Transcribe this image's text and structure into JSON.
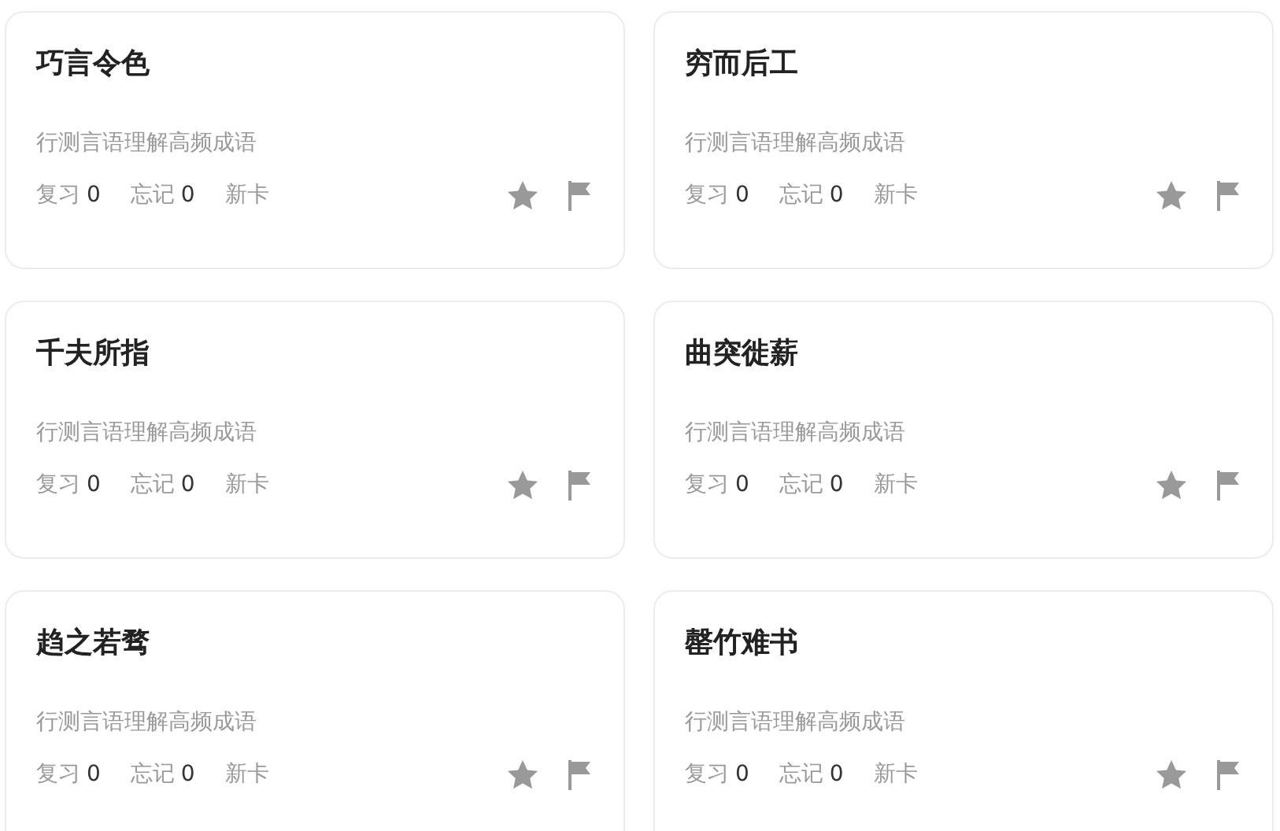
{
  "cards": [
    {
      "title": "巧言令色",
      "subtitle": "行测言语理解高频成语",
      "review_label": "复习",
      "review_count": "0",
      "forget_label": "忘记",
      "forget_count": "0",
      "status": "新卡"
    },
    {
      "title": "穷而后工",
      "subtitle": "行测言语理解高频成语",
      "review_label": "复习",
      "review_count": "0",
      "forget_label": "忘记",
      "forget_count": "0",
      "status": "新卡"
    },
    {
      "title": "千夫所指",
      "subtitle": "行测言语理解高频成语",
      "review_label": "复习",
      "review_count": "0",
      "forget_label": "忘记",
      "forget_count": "0",
      "status": "新卡"
    },
    {
      "title": "曲突徙薪",
      "subtitle": "行测言语理解高频成语",
      "review_label": "复习",
      "review_count": "0",
      "forget_label": "忘记",
      "forget_count": "0",
      "status": "新卡"
    },
    {
      "title": "趋之若骛",
      "subtitle": "行测言语理解高频成语",
      "review_label": "复习",
      "review_count": "0",
      "forget_label": "忘记",
      "forget_count": "0",
      "status": "新卡"
    },
    {
      "title": "罄竹难书",
      "subtitle": "行测言语理解高频成语",
      "review_label": "复习",
      "review_count": "0",
      "forget_label": "忘记",
      "forget_count": "0",
      "status": "新卡"
    }
  ]
}
